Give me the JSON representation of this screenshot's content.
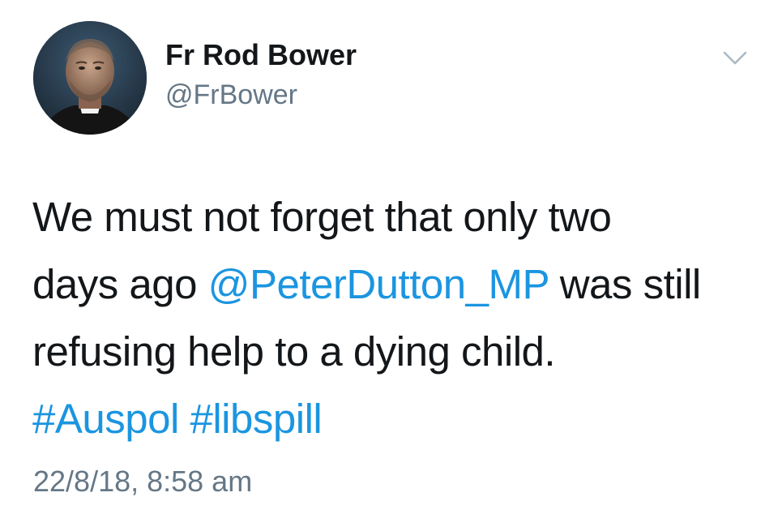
{
  "author": {
    "display_name": "Fr Rod Bower",
    "handle": "@FrBower"
  },
  "icons": {
    "menu": "chevron-down-icon"
  },
  "tweet": {
    "line1": "We must not forget that only two",
    "line2_prefix": "days ago ",
    "mention": "@PeterDutton_MP",
    "line2_suffix": " was still",
    "line3": "refusing help to a dying child.",
    "hashtag1": "#Auspol",
    "hashtag_sep": " ",
    "hashtag2": "#libspill"
  },
  "timestamp": "22/8/18, 8:58 am",
  "colors": {
    "link": "#1b95e0",
    "secondary_text": "#657786",
    "primary_text": "#14171a"
  }
}
